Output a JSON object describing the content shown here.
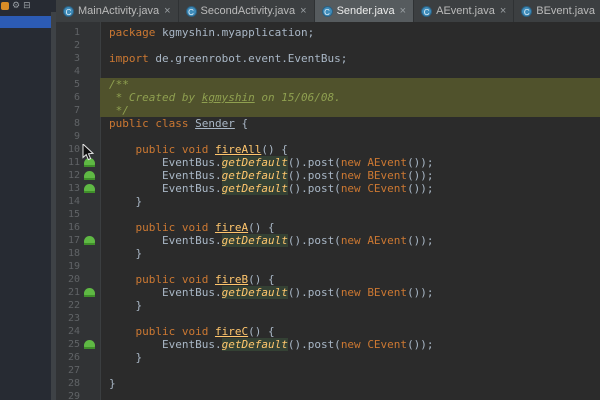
{
  "colors": {
    "editor_bg": "#2b2b2b",
    "gutter_bg": "#313335",
    "keyword_orange": "#cc7832",
    "method_yellow": "#ffc66d",
    "comment_band_bg": "#50522c",
    "comment_text": "#8fa050",
    "selection_blue": "#2c5bb4",
    "gutter_icon_green": "#5fb944",
    "tab_active_bg": "#565b5e"
  },
  "left_panel": {
    "header_icons": [
      "orange-badge-icon",
      "gear-icon",
      "collapse-all-icon"
    ]
  },
  "tabs": [
    {
      "label": "MainActivity.java",
      "active": false
    },
    {
      "label": "SecondActivity.java",
      "active": false
    },
    {
      "label": "Sender.java",
      "active": true
    },
    {
      "label": "AEvent.java",
      "active": false
    },
    {
      "label": "BEvent.java",
      "active": false
    }
  ],
  "editor": {
    "lines": [
      {
        "n": 1,
        "tokens": [
          {
            "t": "kw",
            "s": "package "
          },
          {
            "t": "p",
            "s": "kgmyshin.myapplication;"
          }
        ]
      },
      {
        "n": 2,
        "tokens": []
      },
      {
        "n": 3,
        "tokens": [
          {
            "t": "kw",
            "s": "import "
          },
          {
            "t": "p",
            "s": "de.greenrobot.event.EventBus;"
          }
        ]
      },
      {
        "n": 4,
        "tokens": []
      },
      {
        "n": 5,
        "band": true,
        "tokens": [
          {
            "t": "cm",
            "s": "/**"
          }
        ]
      },
      {
        "n": 6,
        "band": true,
        "tokens": [
          {
            "t": "cm",
            "s": " * Created by "
          },
          {
            "t": "cmu",
            "s": "kgmyshin"
          },
          {
            "t": "cm",
            "s": " on 15/06/08."
          }
        ]
      },
      {
        "n": 7,
        "band": true,
        "tokens": [
          {
            "t": "cm",
            "s": " */"
          }
        ]
      },
      {
        "n": 8,
        "tokens": [
          {
            "t": "kw",
            "s": "public class "
          },
          {
            "t": "cls",
            "s": "Sender"
          },
          {
            "t": "p",
            "s": " {"
          }
        ]
      },
      {
        "n": 9,
        "tokens": []
      },
      {
        "n": 10,
        "tokens": [
          {
            "t": "p",
            "s": "    "
          },
          {
            "t": "kw",
            "s": "public void "
          },
          {
            "t": "m",
            "s": "fireAll"
          },
          {
            "t": "p",
            "s": "() {"
          }
        ]
      },
      {
        "n": 11,
        "icon": true,
        "tokens": [
          {
            "t": "p",
            "s": "        EventBus."
          },
          {
            "t": "sm",
            "s": "getDefault"
          },
          {
            "t": "p",
            "s": "().post("
          },
          {
            "t": "kw",
            "s": "new "
          },
          {
            "t": "ev",
            "s": "AEvent"
          },
          {
            "t": "p",
            "s": "());"
          }
        ]
      },
      {
        "n": 12,
        "icon": true,
        "tokens": [
          {
            "t": "p",
            "s": "        EventBus."
          },
          {
            "t": "sm",
            "s": "getDefault"
          },
          {
            "t": "p",
            "s": "().post("
          },
          {
            "t": "kw",
            "s": "new "
          },
          {
            "t": "ev",
            "s": "BEvent"
          },
          {
            "t": "p",
            "s": "());"
          }
        ]
      },
      {
        "n": 13,
        "icon": true,
        "tokens": [
          {
            "t": "p",
            "s": "        EventBus."
          },
          {
            "t": "sm",
            "s": "getDefault"
          },
          {
            "t": "p",
            "s": "().post("
          },
          {
            "t": "kw",
            "s": "new "
          },
          {
            "t": "ev",
            "s": "CEvent"
          },
          {
            "t": "p",
            "s": "());"
          }
        ]
      },
      {
        "n": 14,
        "tokens": [
          {
            "t": "p",
            "s": "    }"
          }
        ]
      },
      {
        "n": 15,
        "tokens": []
      },
      {
        "n": 16,
        "tokens": [
          {
            "t": "p",
            "s": "    "
          },
          {
            "t": "kw",
            "s": "public void "
          },
          {
            "t": "m",
            "s": "fireA"
          },
          {
            "t": "p",
            "s": "() {"
          }
        ]
      },
      {
        "n": 17,
        "icon": true,
        "tokens": [
          {
            "t": "p",
            "s": "        EventBus."
          },
          {
            "t": "sm",
            "s": "getDefault"
          },
          {
            "t": "p",
            "s": "().post("
          },
          {
            "t": "kw",
            "s": "new "
          },
          {
            "t": "ev",
            "s": "AEvent"
          },
          {
            "t": "p",
            "s": "());"
          }
        ]
      },
      {
        "n": 18,
        "tokens": [
          {
            "t": "p",
            "s": "    }"
          }
        ]
      },
      {
        "n": 19,
        "tokens": []
      },
      {
        "n": 20,
        "tokens": [
          {
            "t": "p",
            "s": "    "
          },
          {
            "t": "kw",
            "s": "public void "
          },
          {
            "t": "m",
            "s": "fireB"
          },
          {
            "t": "p",
            "s": "() {"
          }
        ]
      },
      {
        "n": 21,
        "icon": true,
        "tokens": [
          {
            "t": "p",
            "s": "        EventBus."
          },
          {
            "t": "sm",
            "s": "getDefault"
          },
          {
            "t": "p",
            "s": "().post("
          },
          {
            "t": "kw",
            "s": "new "
          },
          {
            "t": "ev",
            "s": "BEvent"
          },
          {
            "t": "p",
            "s": "());"
          }
        ]
      },
      {
        "n": 22,
        "tokens": [
          {
            "t": "p",
            "s": "    }"
          }
        ]
      },
      {
        "n": 23,
        "tokens": []
      },
      {
        "n": 24,
        "tokens": [
          {
            "t": "p",
            "s": "    "
          },
          {
            "t": "kw",
            "s": "public void "
          },
          {
            "t": "m",
            "s": "fireC"
          },
          {
            "t": "p",
            "s": "() {"
          }
        ]
      },
      {
        "n": 25,
        "icon": true,
        "tokens": [
          {
            "t": "p",
            "s": "        EventBus."
          },
          {
            "t": "sm",
            "s": "getDefault"
          },
          {
            "t": "p",
            "s": "().post("
          },
          {
            "t": "kw",
            "s": "new "
          },
          {
            "t": "ev",
            "s": "CEvent"
          },
          {
            "t": "p",
            "s": "());"
          }
        ]
      },
      {
        "n": 26,
        "tokens": [
          {
            "t": "p",
            "s": "    }"
          }
        ]
      },
      {
        "n": 27,
        "tokens": []
      },
      {
        "n": 28,
        "tokens": [
          {
            "t": "p",
            "s": "}"
          }
        ]
      },
      {
        "n": 29,
        "tokens": []
      }
    ]
  }
}
